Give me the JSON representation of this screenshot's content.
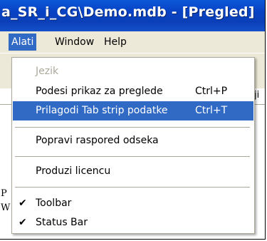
{
  "window": {
    "title": "a_SR_i_CG\\Demo.mdb - [Pregled]"
  },
  "menubar": {
    "items": [
      {
        "label": "Alati"
      },
      {
        "label": "Window"
      },
      {
        "label": "Help"
      }
    ]
  },
  "background": {
    "right_fragment": "ji",
    "left_fragment_1": "P",
    "left_fragment_2": "W"
  },
  "dropdown": {
    "items": [
      {
        "label": "Jezik",
        "shortcut": ""
      },
      {
        "label": "Podesi prikaz za preglede",
        "shortcut": "Ctrl+P"
      },
      {
        "label": "Prilagodi Tab strip podatke",
        "shortcut": "Ctrl+T"
      },
      {
        "label": "Popravi raspored odseka",
        "shortcut": ""
      },
      {
        "label": "Produzi licencu",
        "shortcut": ""
      },
      {
        "label": "Toolbar",
        "shortcut": ""
      },
      {
        "label": "Status Bar",
        "shortcut": ""
      }
    ]
  }
}
